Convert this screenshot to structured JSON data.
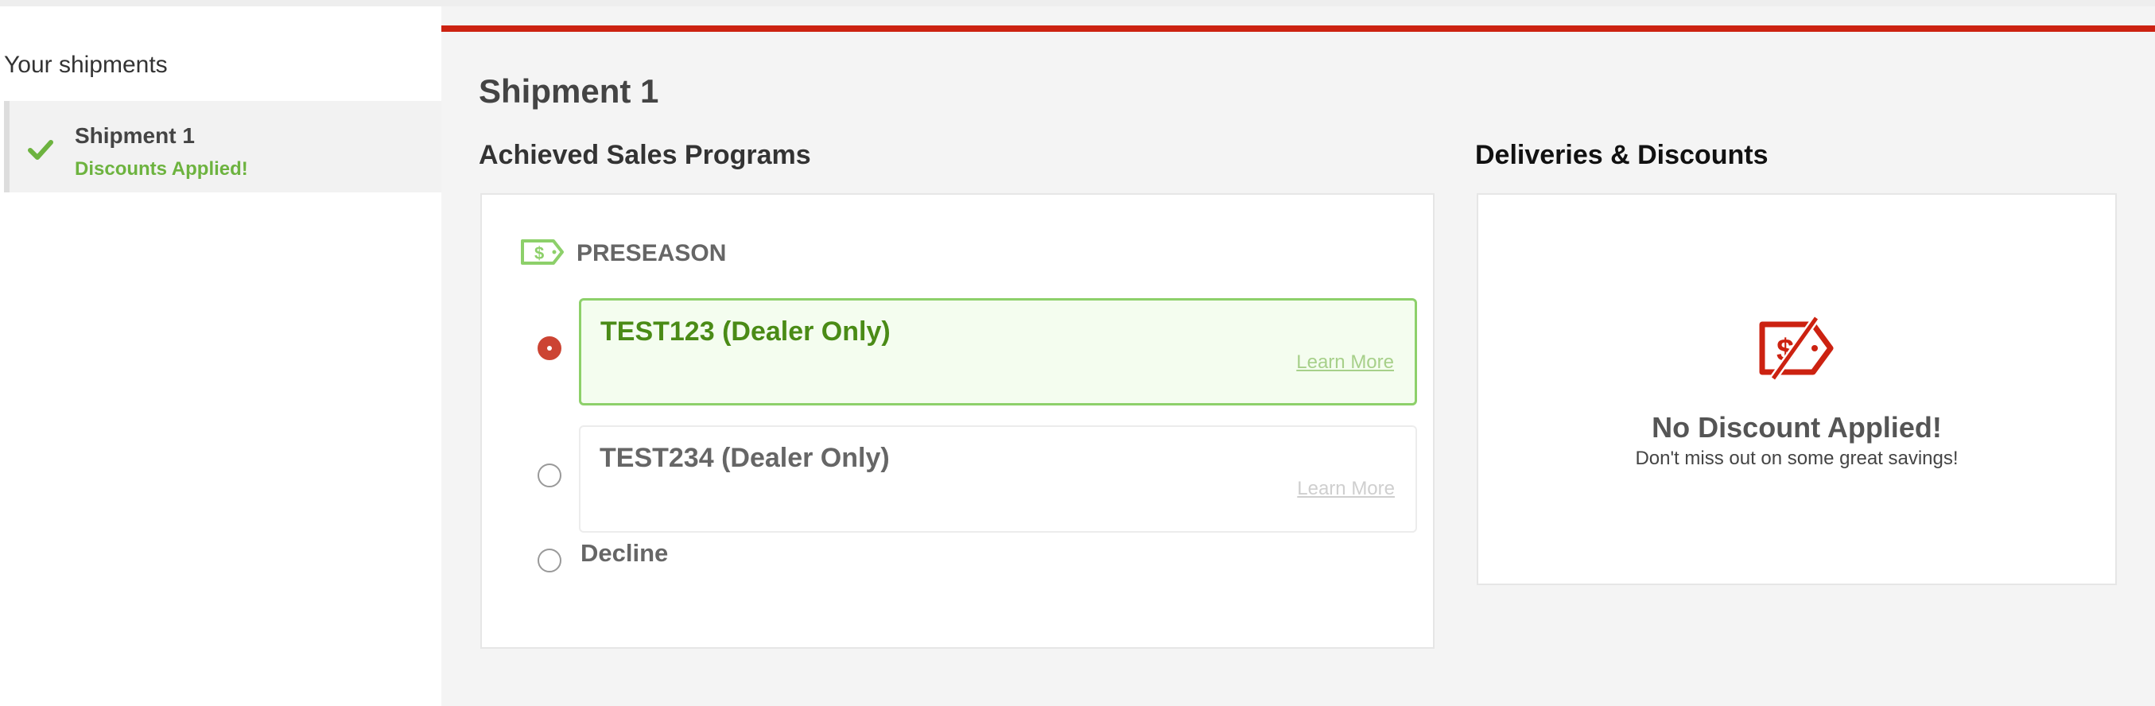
{
  "sidebar": {
    "title": "Your shipments",
    "items": [
      {
        "name": "Shipment 1",
        "status": "Discounts Applied!",
        "icon": "checkmark-icon"
      }
    ]
  },
  "main": {
    "title": "Shipment 1",
    "programs_heading": "Achieved Sales Programs",
    "discounts_heading": "Deliveries & Discounts",
    "program_group": {
      "label": "PRESEASON",
      "icon": "dollar-tag-icon",
      "options": [
        {
          "title": "TEST123 (Dealer Only)",
          "link": "Learn More",
          "selected": true
        },
        {
          "title": "TEST234 (Dealer Only)",
          "link": "Learn More",
          "selected": false
        }
      ],
      "decline_label": "Decline"
    },
    "discount_panel": {
      "icon": "no-discount-tag-icon",
      "title": "No Discount Applied!",
      "subtitle": "Don't miss out on some great savings!"
    }
  },
  "colors": {
    "accent_red": "#cc2211",
    "success_green": "#6db33f",
    "selected_border": "#8dd06a"
  }
}
